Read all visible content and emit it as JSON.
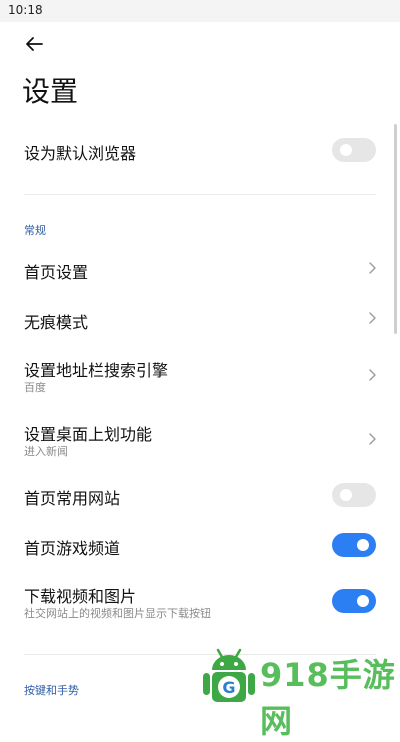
{
  "status": {
    "time": "10:18"
  },
  "header": {
    "title": "设置"
  },
  "rows": {
    "default_browser": {
      "title": "设为默认浏览器",
      "toggle": "off"
    },
    "homepage_settings": {
      "title": "首页设置"
    },
    "incognito": {
      "title": "无痕模式"
    },
    "search_engine": {
      "title": "设置地址栏搜索引擎",
      "subtitle": "百度"
    },
    "swipe_function": {
      "title": "设置桌面上划功能",
      "subtitle": "进入新闻"
    },
    "common_sites": {
      "title": "首页常用网站",
      "toggle": "off"
    },
    "game_channel": {
      "title": "首页游戏频道",
      "toggle": "on"
    },
    "download_media": {
      "title": "下载视频和图片",
      "subtitle": "社交网站上的视频和图片显示下载按钮",
      "toggle": "on"
    }
  },
  "sections": {
    "general": "常规",
    "keys_gestures": "按键和手势"
  },
  "watermark": {
    "text": "918手游网",
    "letter": "G"
  },
  "colors": {
    "accent": "#2b7ff2",
    "section": "#2f5ea8",
    "toggle_off": "#e6e6e6"
  }
}
